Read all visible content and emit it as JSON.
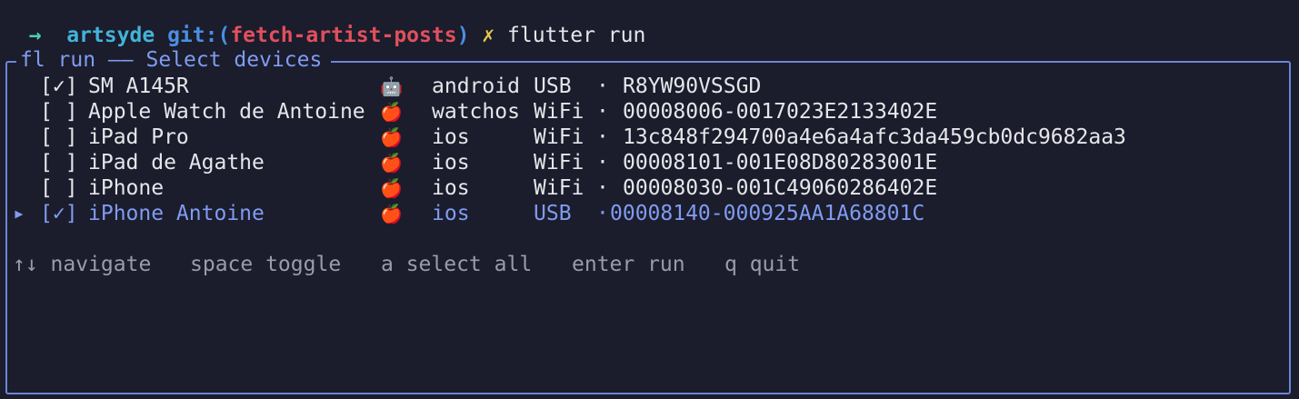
{
  "prompt": {
    "arrow": "→",
    "dir": "artsyde",
    "git_prefix": "git:(",
    "branch": "fetch-artist-posts",
    "git_suffix": ")",
    "dirty_mark": "✗",
    "command": "flutter run"
  },
  "panel": {
    "title": "fl run —— Select devices"
  },
  "devices": [
    {
      "checkbox": "[✓]",
      "name": "SM A145R",
      "icon": "🤖",
      "platform": "android",
      "connection": "USB",
      "separator": "·",
      "id": "R8YW90VSSGD",
      "cursor": ""
    },
    {
      "checkbox": "[ ]",
      "name": "Apple Watch de Antoine",
      "icon": "🍎",
      "platform": "watchos",
      "connection": "WiFi",
      "separator": "·",
      "id": "00008006-0017023E2133402E",
      "cursor": ""
    },
    {
      "checkbox": "[ ]",
      "name": "iPad Pro",
      "icon": "🍎",
      "platform": "ios",
      "connection": "WiFi",
      "separator": "·",
      "id": "13c848f294700a4e6a4afc3da459cb0dc9682aa3",
      "cursor": ""
    },
    {
      "checkbox": "[ ]",
      "name": "iPad de Agathe",
      "icon": "🍎",
      "platform": "ios",
      "connection": "WiFi",
      "separator": "·",
      "id": "00008101-001E08D80283001E",
      "cursor": ""
    },
    {
      "checkbox": "[ ]",
      "name": "iPhone",
      "icon": "🍎",
      "platform": "ios",
      "connection": "WiFi",
      "separator": "·",
      "id": "00008030-001C49060286402E",
      "cursor": ""
    },
    {
      "checkbox": "[✓]",
      "name": "iPhone Antoine",
      "icon": "🍎",
      "platform": "ios",
      "connection": "USB",
      "separator": "·",
      "id": "00008140-000925AA1A68801C",
      "cursor": "▸"
    }
  ],
  "help": {
    "navigate": "↑↓ navigate",
    "toggle": "space toggle",
    "select_all": "a select all",
    "run": "enter run",
    "quit": "q quit"
  },
  "colors": {
    "background": "#1b1c2c",
    "accent": "#7f9cf0",
    "border": "#6c86d4",
    "branch": "#e0505e",
    "muted": "#9a9caa"
  }
}
